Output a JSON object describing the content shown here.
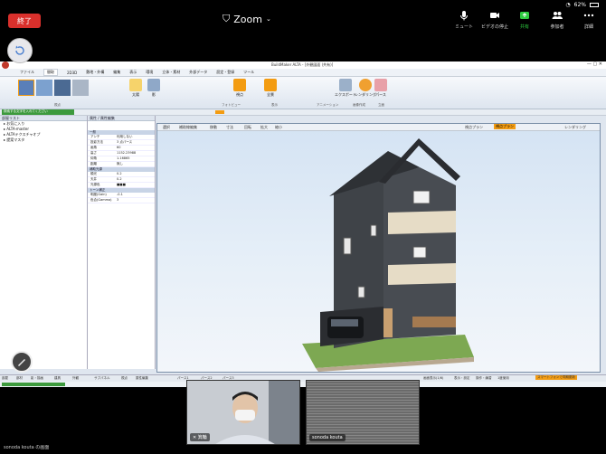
{
  "zoom": {
    "end_label": "終了",
    "title": "Zoom",
    "status": {
      "battery": "62%"
    },
    "toolbar": [
      {
        "label": "ミュート",
        "icon": "mic-icon"
      },
      {
        "label": "ビデオの停止",
        "icon": "video-icon"
      },
      {
        "label": "共有",
        "icon": "share-icon"
      },
      {
        "label": "参加者",
        "icon": "participants-icon"
      },
      {
        "label": "詳細",
        "icon": "more-icon"
      }
    ]
  },
  "app": {
    "title": "BuildMaker ALTA - [外観図面 (共有)]",
    "menu": [
      "ファイル",
      "間取",
      "2D3D",
      "敷地・外構",
      "編集",
      "表示",
      "環境",
      "立体・素材",
      "外部データ",
      "設定・登録",
      "ツール"
    ],
    "active_menu": "間取",
    "ribbon_groups": [
      "視点",
      "フォトビュー",
      "表示",
      "アニメーション",
      "画像作成",
      "立面"
    ],
    "ribbon_buttons": [
      "太陽",
      "影",
      "視点",
      "全景",
      "エクスポート",
      "レンダリング",
      "パース"
    ],
    "left_panel_header": "部屋リスト",
    "left_panel_search": "検索する文字を入れてください",
    "tree": [
      "お気に入り",
      "ALTA-master",
      "ALTAテクスチャオプ",
      "提案マスタ"
    ],
    "prop_panel_header": "属性 / 属性編集",
    "prop_sections": [
      {
        "title": "一般",
        "rows": [
          [
            "アンチ",
            "利用しない"
          ],
          [
            "投影方法",
            "3 点パース"
          ],
          [
            "画角",
            "60"
          ],
          [
            "高さ",
            "1152.23988"
          ],
          [
            "仰角",
            "1.16865"
          ],
          [
            "距離",
            "無し"
          ]
        ]
      },
      {
        "title": "補助光源",
        "rows": [
          [
            "順光",
            "0.2"
          ],
          [
            "天井",
            "0.2"
          ],
          [
            "光源色",
            "■■■"
          ]
        ]
      },
      {
        "title": "トーン補正",
        "rows": [
          [
            "明度(Gain)",
            "-0.1"
          ],
          [
            "色合(Gamma)",
            "3"
          ]
        ]
      }
    ],
    "viewport_toolbar": [
      "選択",
      "補助線編集",
      "移動",
      "寸法",
      "回転",
      "拡大",
      "縮小"
    ],
    "viewport_right": [
      "視点プラン",
      "視点プラン",
      "レンダリング"
    ],
    "bottom_tabs": [
      "パース1",
      "パース2",
      "パース3"
    ],
    "status_left": [
      "部屋",
      "部材",
      "影・描画",
      "建具",
      "外観",
      "サブパネル",
      "視点",
      "属性編集"
    ],
    "status_right": [
      "画面表示(1/6)",
      "表示・設定",
      "操作・練習",
      "1度使用",
      "スマートフォンで同期更新"
    ]
  },
  "participants": [
    {
      "name": "箕輪",
      "icon": "mic-off-icon"
    },
    {
      "name": "sonoda kouta"
    }
  ],
  "self_label": "sonoda kouta の画面",
  "colors": {
    "accent_orange": "#f39c12",
    "zoom_red": "#d9302c",
    "zoom_green": "#2ecc40"
  }
}
